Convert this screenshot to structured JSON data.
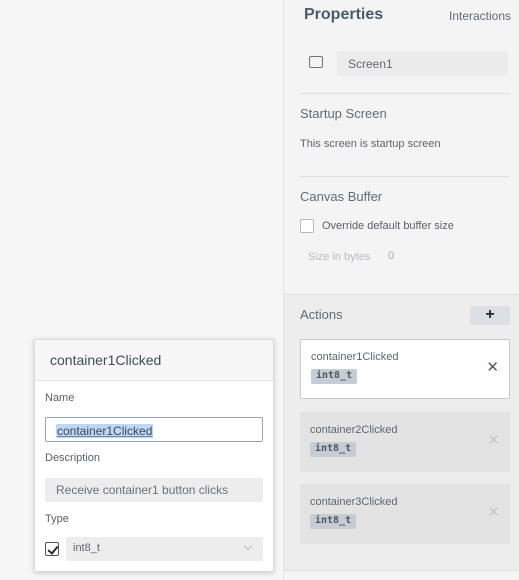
{
  "panel": {
    "tabs": {
      "properties": "Properties",
      "interactions": "Interactions"
    },
    "screen": {
      "icon": "screen-icon",
      "name": "Screen1"
    },
    "startup": {
      "title": "Startup Screen",
      "text": "This screen is startup screen"
    },
    "canvas_buffer": {
      "title": "Canvas Buffer",
      "override_label": "Override default buffer size",
      "override_checked": false,
      "size_label": "Size in bytes",
      "size_value": "0"
    },
    "actions": {
      "title": "Actions",
      "add_label": "+",
      "items": [
        {
          "name": "container1Clicked",
          "type": "int8_t",
          "remove": "✕",
          "active": true
        },
        {
          "name": "container2Clicked",
          "type": "int8_t",
          "remove": "✕",
          "active": false
        },
        {
          "name": "container3Clicked",
          "type": "int8_t",
          "remove": "✕",
          "active": false
        }
      ]
    }
  },
  "popup": {
    "title": "container1Clicked",
    "name_label": "Name",
    "name_value": "container1Clicked",
    "description_label": "Description",
    "description_value": "Receive container1 button clicks",
    "type_label": "Type",
    "type_checked": true,
    "type_value": "int8_t"
  }
}
